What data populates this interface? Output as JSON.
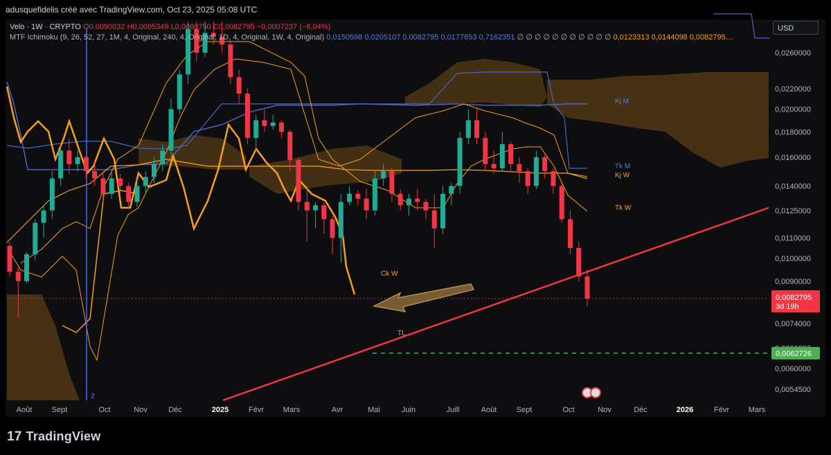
{
  "header": {
    "attribution": "adusquefidelis créé avec TradingView.com, Oct 23, 2025 05:08 UTC"
  },
  "legend": {
    "symbol": "Velo · 1W · CRYPTO",
    "open": "O0,0090032",
    "high": "H0,0095349",
    "low": "L0,0080750",
    "close": "C0,0082795",
    "change": "−0,0007237 (−8,04%)",
    "indicator": "MTF Ichimoku (9, 26, 52, 27, 1M, 4, Original, 240, 4, Original, 1D, 4, Original, 1W, 4, Original)",
    "values_blue": "0,0150598  0,0205107  0,0082795  0,0177853  0,7162351",
    "empty_marks": "∅ ∅ ∅ ∅ ∅ ∅ ∅ ∅ ∅ ∅ ∅",
    "values_orange": "0,0123313  0,0144098  0,0082795…"
  },
  "currency_button": "USD",
  "price_tags": {
    "last_price": "0,0082795",
    "countdown": "3d 19h",
    "target_price": "0,0062726"
  },
  "colors": {
    "up": "#22ab94",
    "down": "#f23645",
    "orange": "#f7a11a",
    "blue": "#4b64c8",
    "cloud": "#6b4a1c"
  },
  "footer": {
    "brand": "TradingView"
  },
  "annotations": {
    "ck_w": "Ck W",
    "kj_m": "Kj M",
    "tk_m": "Tk M",
    "kj_w": "Kj W",
    "tk_w": "Tk W",
    "tl": "TL",
    "marker": "2"
  },
  "chart_data": {
    "type": "candlestick",
    "title": "",
    "y_scale": "log",
    "ylim": [
      0.005,
      0.03
    ],
    "y_ticks": [
      0.00545,
      0.006,
      0.0066,
      0.0074,
      0.009,
      0.01,
      0.011,
      0.0125,
      0.014,
      0.016,
      0.018,
      0.02,
      0.022,
      0.026
    ],
    "y_tick_labels": [
      "0,0054500",
      "0,0060000",
      "0,0066000",
      "0,0074000",
      "0,0090000",
      "0,0100000",
      "0,0110000",
      "0,0125000",
      "0,0140000",
      "0,0160000",
      "0,0180000",
      "0,0200000",
      "0,0220000",
      "0,0260000"
    ],
    "x_ticks": [
      "Août",
      "Sept",
      "Oct",
      "Nov",
      "Déc",
      "2025",
      "Févr",
      "Mars",
      "Avr",
      "Mai",
      "Juin",
      "Juill",
      "Août",
      "Sept",
      "Oct",
      "Nov",
      "Déc",
      "2026",
      "Févr",
      "Mars"
    ],
    "x_tick_bold": [
      "2025",
      "2026"
    ],
    "candles": [
      [
        0.0106,
        0.0108,
        0.0092,
        0.0094
      ],
      [
        0.0094,
        0.0096,
        0.0076,
        0.009
      ],
      [
        0.009,
        0.0103,
        0.0089,
        0.0102
      ],
      [
        0.0102,
        0.012,
        0.0099,
        0.0118
      ],
      [
        0.0118,
        0.0128,
        0.011,
        0.0125
      ],
      [
        0.0125,
        0.015,
        0.012,
        0.0145
      ],
      [
        0.0145,
        0.017,
        0.014,
        0.0165
      ],
      [
        0.0165,
        0.0175,
        0.0148,
        0.0155
      ],
      [
        0.0155,
        0.0165,
        0.015,
        0.016
      ],
      [
        0.016,
        0.0162,
        0.0145,
        0.015
      ],
      [
        0.015,
        0.0158,
        0.014,
        0.0145
      ],
      [
        0.0145,
        0.015,
        0.013,
        0.0135
      ],
      [
        0.0135,
        0.015,
        0.0132,
        0.0145
      ],
      [
        0.0145,
        0.0148,
        0.0135,
        0.014
      ],
      [
        0.014,
        0.0142,
        0.0126,
        0.013
      ],
      [
        0.013,
        0.0145,
        0.0127,
        0.014
      ],
      [
        0.014,
        0.015,
        0.0136,
        0.0146
      ],
      [
        0.0146,
        0.016,
        0.0142,
        0.0155
      ],
      [
        0.0155,
        0.017,
        0.015,
        0.0165
      ],
      [
        0.0165,
        0.021,
        0.016,
        0.02
      ],
      [
        0.02,
        0.024,
        0.0195,
        0.0235
      ],
      [
        0.0235,
        0.03,
        0.0225,
        0.029
      ],
      [
        0.029,
        0.03,
        0.025,
        0.026
      ],
      [
        0.026,
        0.03,
        0.0255,
        0.0285
      ],
      [
        0.0285,
        0.03,
        0.027,
        0.028
      ],
      [
        0.028,
        0.03,
        0.026,
        0.027
      ],
      [
        0.027,
        0.0275,
        0.0225,
        0.0232
      ],
      [
        0.0232,
        0.024,
        0.0205,
        0.0215
      ],
      [
        0.0215,
        0.022,
        0.017,
        0.0175
      ],
      [
        0.0175,
        0.0195,
        0.0165,
        0.019
      ],
      [
        0.019,
        0.02,
        0.018,
        0.0185
      ],
      [
        0.0185,
        0.0195,
        0.0182,
        0.0188
      ],
      [
        0.0188,
        0.019,
        0.0175,
        0.018
      ],
      [
        0.018,
        0.0182,
        0.015,
        0.0158
      ],
      [
        0.0158,
        0.016,
        0.0125,
        0.013
      ],
      [
        0.013,
        0.014,
        0.0108,
        0.0125
      ],
      [
        0.0125,
        0.013,
        0.0115,
        0.0128
      ],
      [
        0.0128,
        0.013,
        0.0112,
        0.012
      ],
      [
        0.012,
        0.0122,
        0.0102,
        0.011
      ],
      [
        0.011,
        0.0135,
        0.0098,
        0.013
      ],
      [
        0.013,
        0.014,
        0.0128,
        0.0135
      ],
      [
        0.0135,
        0.0137,
        0.0128,
        0.0132
      ],
      [
        0.0132,
        0.0138,
        0.012,
        0.0125
      ],
      [
        0.0125,
        0.015,
        0.0122,
        0.0145
      ],
      [
        0.0145,
        0.0155,
        0.014,
        0.015
      ],
      [
        0.015,
        0.0152,
        0.013,
        0.0135
      ],
      [
        0.0135,
        0.0138,
        0.0125,
        0.0128
      ],
      [
        0.0128,
        0.0135,
        0.0122,
        0.0132
      ],
      [
        0.0132,
        0.0138,
        0.0125,
        0.013
      ],
      [
        0.013,
        0.0132,
        0.012,
        0.0125
      ],
      [
        0.0125,
        0.0135,
        0.0105,
        0.0115
      ],
      [
        0.0115,
        0.014,
        0.0112,
        0.0135
      ],
      [
        0.0135,
        0.0142,
        0.0128,
        0.014
      ],
      [
        0.014,
        0.018,
        0.0135,
        0.0175
      ],
      [
        0.0175,
        0.02,
        0.017,
        0.019
      ],
      [
        0.019,
        0.02,
        0.017,
        0.0175
      ],
      [
        0.0175,
        0.018,
        0.015,
        0.0155
      ],
      [
        0.0155,
        0.0165,
        0.0148,
        0.0152
      ],
      [
        0.0152,
        0.018,
        0.015,
        0.017
      ],
      [
        0.017,
        0.0172,
        0.015,
        0.0155
      ],
      [
        0.0155,
        0.016,
        0.0142,
        0.015
      ],
      [
        0.015,
        0.0152,
        0.0135,
        0.014
      ],
      [
        0.014,
        0.0165,
        0.0138,
        0.016
      ],
      [
        0.016,
        0.0162,
        0.0145,
        0.015
      ],
      [
        0.015,
        0.0152,
        0.0135,
        0.014
      ],
      [
        0.014,
        0.0142,
        0.0118,
        0.012
      ],
      [
        0.012,
        0.0125,
        0.0102,
        0.0105
      ],
      [
        0.0105,
        0.0108,
        0.009,
        0.0092
      ],
      [
        0.0092,
        0.0095,
        0.008,
        0.0083
      ]
    ]
  }
}
